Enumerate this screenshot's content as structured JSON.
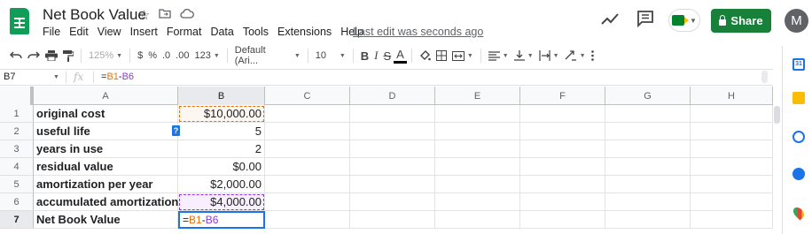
{
  "app": {
    "title": "Net Book Value",
    "menu": [
      "File",
      "Edit",
      "View",
      "Insert",
      "Format",
      "Data",
      "Tools",
      "Extensions",
      "Help"
    ],
    "last_edit": "Last edit was seconds ago",
    "share_label": "Share",
    "avatar_initial": "M",
    "brand_color": "#0f9d58",
    "share_color": "#188038"
  },
  "toolbar": {
    "zoom": "125%",
    "currency": "$",
    "percent": "%",
    "decrease_decimal": ".0",
    "increase_decimal": ".00",
    "more_formats": "123",
    "font": "Default (Ari...",
    "font_size": "10",
    "bold": "B",
    "italic": "I",
    "strikethrough": "S",
    "text_color": "A"
  },
  "formula_bar": {
    "cell_ref": "B7",
    "fx": "fx",
    "formula_eq": "=",
    "formula_ref1": "B1",
    "formula_op": "-",
    "formula_ref2": "B6"
  },
  "grid": {
    "columns": [
      "A",
      "B",
      "C",
      "D",
      "E",
      "F",
      "G",
      "H"
    ],
    "rows": [
      {
        "num": "1",
        "label": "original cost",
        "value": "$10,000.00"
      },
      {
        "num": "2",
        "label": "useful life",
        "value": "5"
      },
      {
        "num": "3",
        "label": "years in use",
        "value": "2"
      },
      {
        "num": "4",
        "label": "residual value",
        "value": "$0.00"
      },
      {
        "num": "5",
        "label": "amortization per year",
        "value": "$2,000.00"
      },
      {
        "num": "6",
        "label": "accumulated amortization",
        "value": "$4,000.00"
      },
      {
        "num": "7",
        "label": "Net Book Value",
        "value": ""
      }
    ],
    "editing": {
      "eq": "=",
      "ref1": "B1",
      "op": "-",
      "ref2": "B6"
    },
    "help_chip": "?",
    "ref_color_1": "#e8710a",
    "ref_color_2": "#9334e6",
    "selection_color": "#1a73e8"
  },
  "side_panel": {
    "calendar_label": "31",
    "icons": [
      "calendar-icon",
      "keep-icon",
      "tasks-icon",
      "contacts-icon",
      "maps-icon"
    ]
  }
}
